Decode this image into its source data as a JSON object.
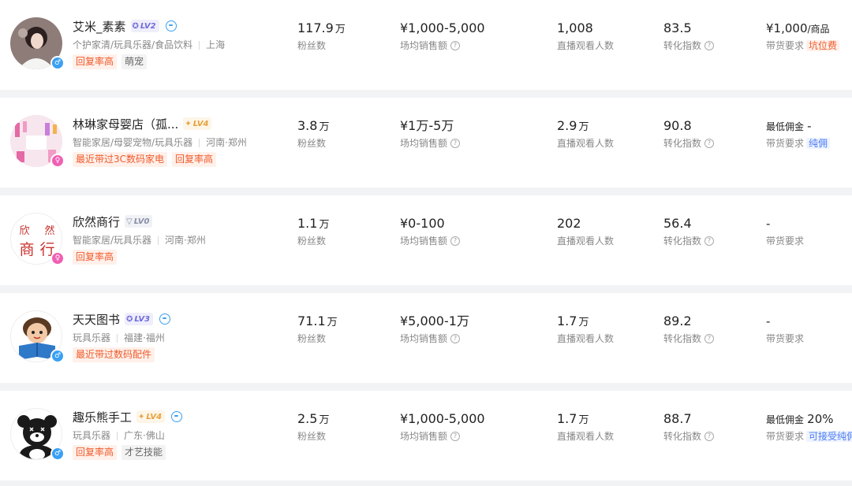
{
  "cards": [
    {
      "name": "艾米_素素",
      "level": "LV2",
      "categories": "个护家清/玩具乐器/食品饮料",
      "location": "上海",
      "tags": [
        "回复率高",
        "萌宠"
      ],
      "fans_value": "117.9",
      "fans_unit": "万",
      "fans_label": "粉丝数",
      "sales_value": "¥1,000-5,000",
      "sales_label": "场均销售额",
      "viewers_value": "1,008",
      "viewers_unit": "",
      "viewers_label": "直播观看人数",
      "conversion_value": "83.5",
      "conversion_label": "转化指数",
      "req_top_value": "¥1,000",
      "req_top_suffix": "/商品",
      "req_label": "带货要求",
      "req_badge": "坑位费"
    },
    {
      "name": "林琳家母婴店（孤...",
      "level": "LV4",
      "categories": "智能家居/母婴宠物/玩具乐器",
      "location": "河南·郑州",
      "tags": [
        "最近带过3C数码家电",
        "回复率高"
      ],
      "fans_value": "3.8",
      "fans_unit": "万",
      "fans_label": "粉丝数",
      "sales_value": "¥1万-5万",
      "sales_label": "场均销售额",
      "viewers_value": "2.9",
      "viewers_unit": "万",
      "viewers_label": "直播观看人数",
      "conversion_value": "90.8",
      "conversion_label": "转化指数",
      "req_top_label": "最低佣金",
      "req_top_value": "-",
      "req_label": "带货要求",
      "req_badge": "纯佣"
    },
    {
      "name": "欣然商行",
      "level": "LV0",
      "categories": "智能家居/玩具乐器",
      "location": "河南·郑州",
      "tags": [
        "回复率高"
      ],
      "avatar_text": [
        "欣",
        "然",
        "商",
        "行"
      ],
      "fans_value": "1.1",
      "fans_unit": "万",
      "fans_label": "粉丝数",
      "sales_value": "¥0-100",
      "sales_label": "场均销售额",
      "viewers_value": "202",
      "viewers_unit": "",
      "viewers_label": "直播观看人数",
      "conversion_value": "56.4",
      "conversion_label": "转化指数",
      "req_top_value": "-",
      "req_label": "带货要求"
    },
    {
      "name": "天天图书",
      "level": "LV3",
      "categories": "玩具乐器",
      "location": "福建·福州",
      "tags": [
        "最近带过数码配件"
      ],
      "fans_value": "71.1",
      "fans_unit": "万",
      "fans_label": "粉丝数",
      "sales_value": "¥5,000-1万",
      "sales_label": "场均销售额",
      "viewers_value": "1.7",
      "viewers_unit": "万",
      "viewers_label": "直播观看人数",
      "conversion_value": "89.2",
      "conversion_label": "转化指数",
      "req_top_value": "-",
      "req_label": "带货要求"
    },
    {
      "name": "趣乐熊手工",
      "level": "LV4",
      "categories": "玩具乐器",
      "location": "广东·佛山",
      "tags": [
        "回复率高",
        "才艺技能"
      ],
      "fans_value": "2.5",
      "fans_unit": "万",
      "fans_label": "粉丝数",
      "sales_value": "¥1,000-5,000",
      "sales_label": "场均销售额",
      "viewers_value": "1.7",
      "viewers_unit": "万",
      "viewers_label": "直播观看人数",
      "conversion_value": "88.7",
      "conversion_label": "转化指数",
      "req_top_label": "最低佣金",
      "req_top_value": "20%",
      "req_label": "带货要求",
      "req_badge": "可接受纯佣"
    }
  ],
  "icons": {
    "gender_male": "male-icon",
    "gender_female": "female-icon",
    "question": "question-icon",
    "chat": "chat-bubble-icon"
  },
  "colors": {
    "tag_red": "#f05a2b",
    "badge_blue": "#4b7bf5",
    "male": "#3aa0f3",
    "female": "#f05fb3"
  }
}
